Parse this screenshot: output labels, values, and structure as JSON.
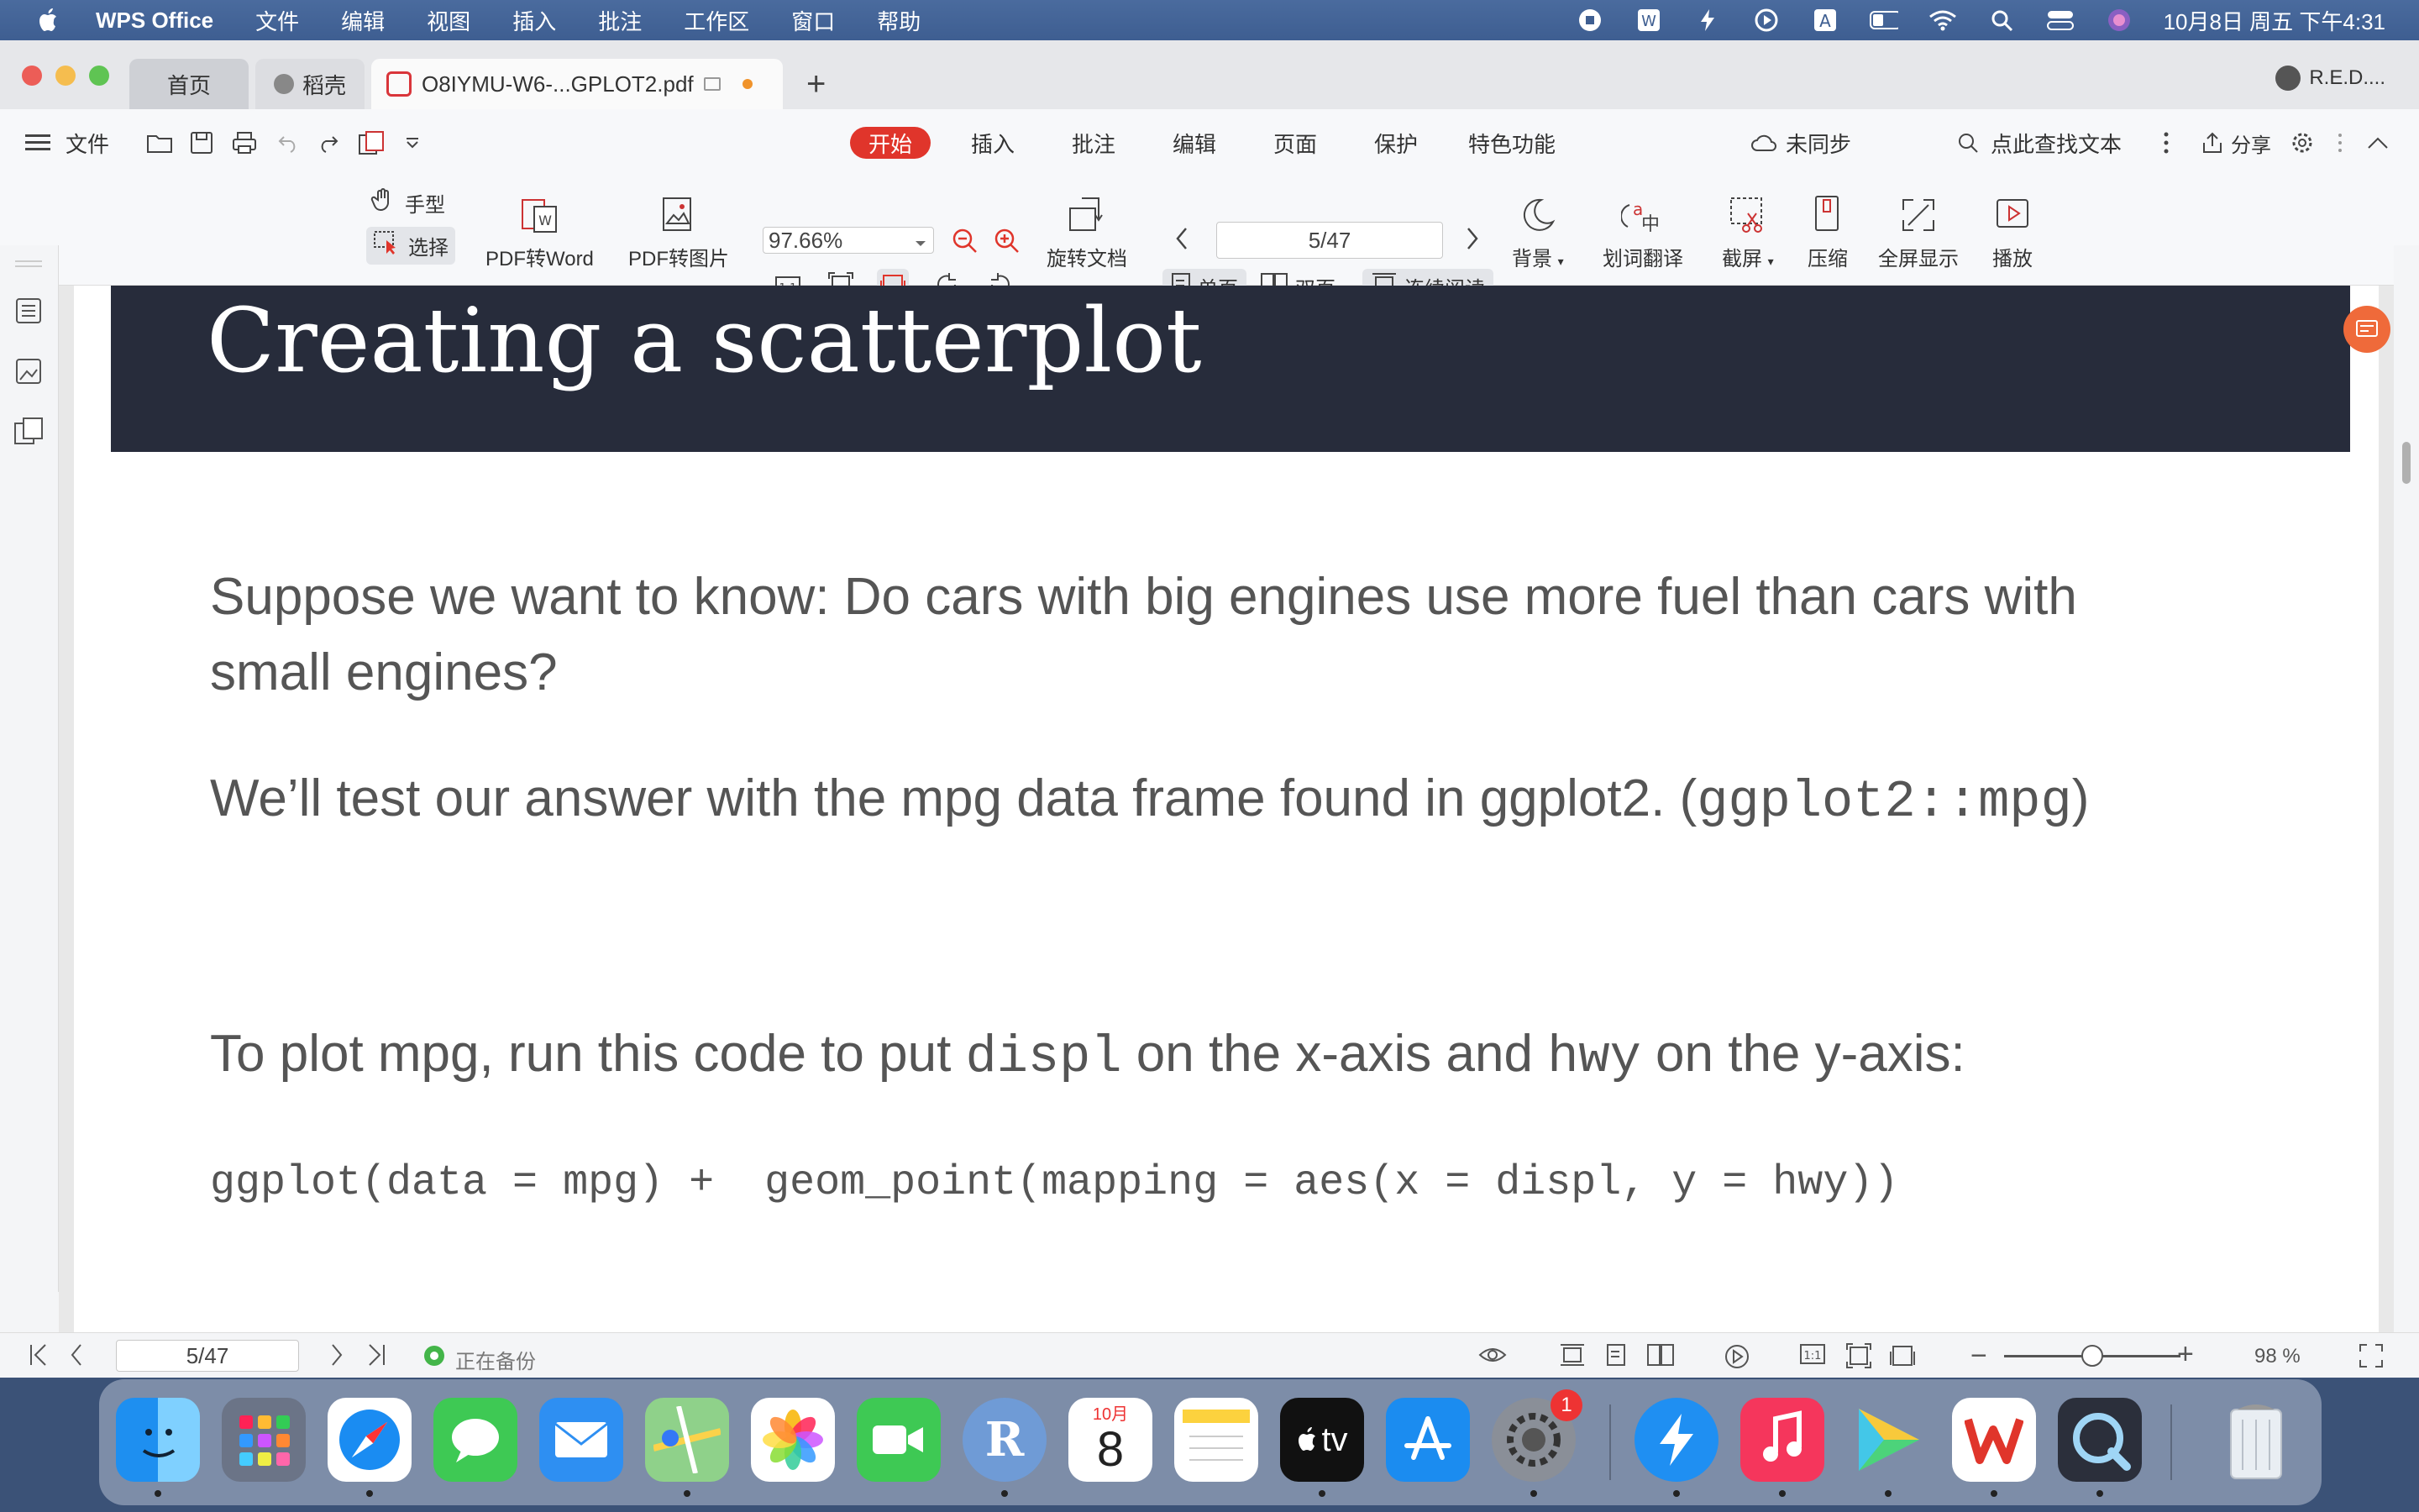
{
  "menubar": {
    "app_name": "WPS Office",
    "items": [
      "文件",
      "编辑",
      "视图",
      "插入",
      "批注",
      "工作区",
      "窗口",
      "帮助"
    ],
    "datetime": "10月8日 周五 下午4:31"
  },
  "tabs": {
    "home": "首页",
    "daoke": "稻壳",
    "pdf": "O8IYMU-W6-...GPLOT2.pdf",
    "account": "R.E.D...."
  },
  "toolbar1": {
    "file": "文件",
    "start": "开始",
    "insert": "插入",
    "annotate": "批注",
    "edit": "编辑",
    "page": "页面",
    "protect": "保护",
    "special": "特色功能",
    "unsynced": "未同步",
    "search": "点此查找文本",
    "share": "分享"
  },
  "toolbar2": {
    "hand": "手型",
    "select": "选择",
    "pdf_to_word": "PDF转Word",
    "pdf_to_image": "PDF转图片",
    "zoom": "97.66%",
    "rotate_doc": "旋转文档",
    "page_input": "5/47",
    "single_page": "单页",
    "double_page": "双页",
    "continuous": "连续阅读",
    "background": "背景",
    "translate": "划词翻译",
    "screenshot": "截屏",
    "compress": "压缩",
    "fullscreen": "全屏显示",
    "play": "播放"
  },
  "slide": {
    "title": "Creating a scatterplot",
    "para1_line1": "Suppose we want to know: Do cars with big engines use more fuel than cars with",
    "para1_line2": "small engines?",
    "para2_text": "We’ll test our answer with the mpg data frame found in ggplot2. (",
    "para2_code": "ggplot2::mpg",
    "para2_end": ")",
    "para3_a": "To plot mpg, run this code to put ",
    "para3_code1": "displ",
    "para3_b": " on the x-axis and ",
    "para3_code2": "hwy",
    "para3_c": " on the y-axis:",
    "code": "ggplot(data = mpg) +  geom_point(mapping = aes(x = displ, y = hwy))"
  },
  "statusbar": {
    "page": "5/47",
    "backup": "正在备份",
    "zoom": "98 %"
  },
  "dock": {
    "calendar_month": "10月",
    "calendar_day": "8",
    "settings_badge": "1",
    "r_label": "R",
    "tv_label": "tv"
  },
  "colors": {
    "accent": "#e0352b",
    "slide_header": "#272c3b"
  }
}
